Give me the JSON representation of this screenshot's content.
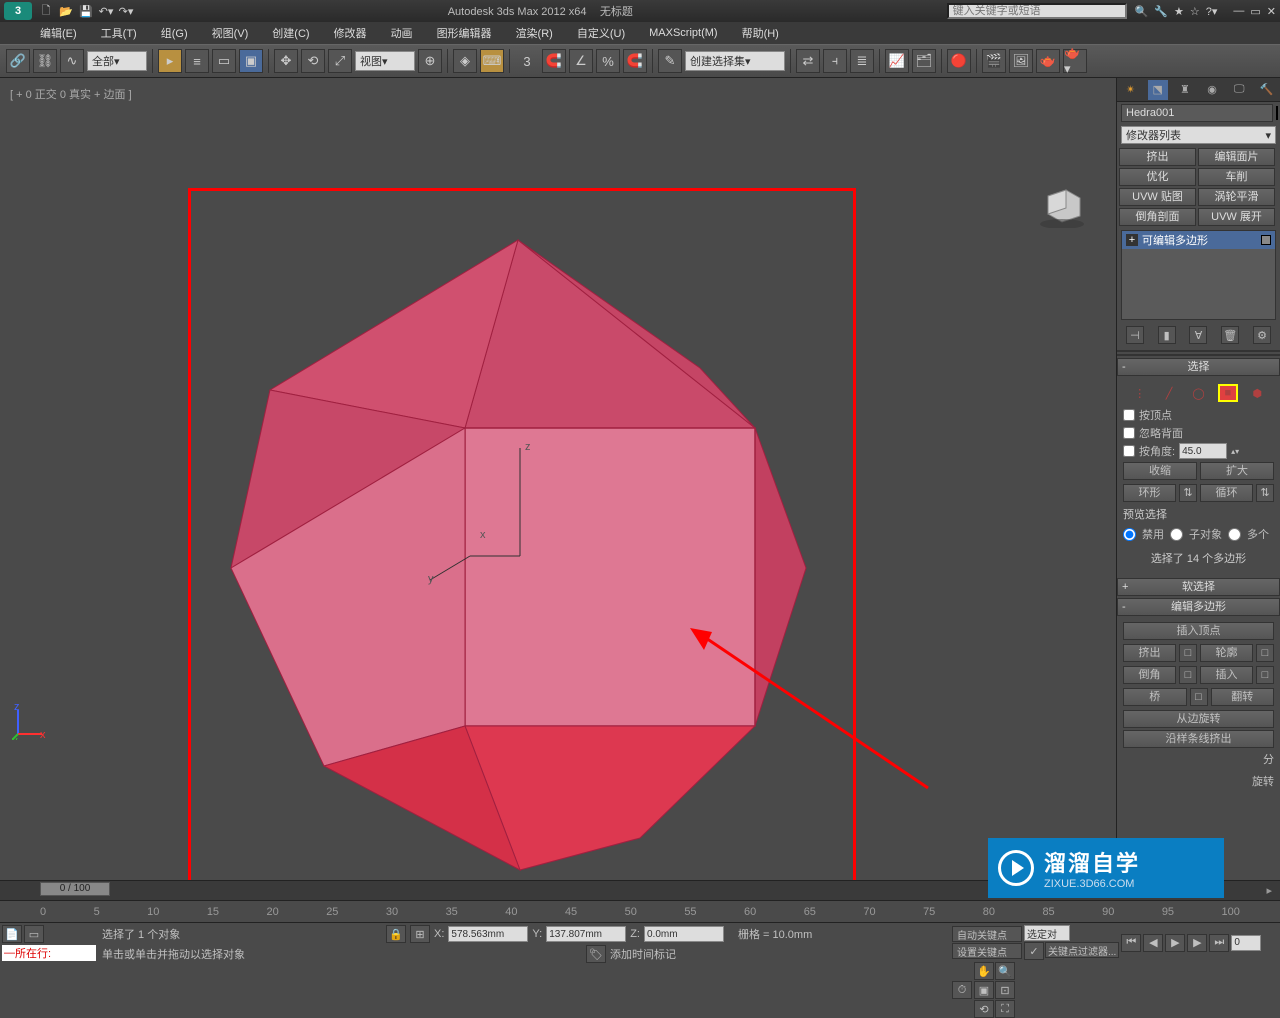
{
  "title": "Autodesk 3ds Max  2012 x64",
  "doc_title": "无标题",
  "search_placeholder": "键入关键字或短语",
  "menu": {
    "edit": "编辑(E)",
    "tools": "工具(T)",
    "group": "组(G)",
    "views": "视图(V)",
    "create": "创建(C)",
    "modifiers": "修改器",
    "anim": "动画",
    "graph": "图形编辑器",
    "render": "渲染(R)",
    "custom": "自定义(U)",
    "max": "MAXScript(M)",
    "help": "帮助(H)"
  },
  "filter_all": "全部",
  "view_dropdown": "视图",
  "create_set": "创建选择集",
  "vp_label": "[ + 0 正交 0 真实 + 边面 ]",
  "object_name": "Hedra001",
  "modifier_list": "修改器列表",
  "mod_buttons": {
    "extrude": "挤出",
    "editface": "编辑面片",
    "optimize": "优化",
    "lathe": "车削",
    "uvwmap": "UVW 贴图",
    "turbo": "涡轮平滑",
    "chamfer": "倒角剖面",
    "uvwunwrap": "UVW 展开"
  },
  "edit_poly_label": "可编辑多边形",
  "rollout_select": "选择",
  "by_vertex": "按顶点",
  "ignore_back": "忽略背面",
  "by_angle": "按角度:",
  "angle_val": "45.0",
  "shrink": "收缩",
  "grow": "扩大",
  "ring": "环形",
  "loop": "循环",
  "preview_sel": "预览选择",
  "radio_disable": "禁用",
  "radio_subobj": "子对象",
  "radio_multi": "多个",
  "sel_count": "选择了 14 个多边形",
  "rollout_soft": "软选择",
  "rollout_editpoly": "编辑多边形",
  "insert_vertex": "插入顶点",
  "ep_extrude": "挤出",
  "ep_outline": "轮廓",
  "ep_bevel": "倒角",
  "ep_insert": "插入",
  "ep_bridge": "桥",
  "ep_flip": "翻转",
  "from_edge": "从边旋转",
  "along_spline": "沿样条线挤出",
  "split": "分",
  "rotate": "旋转",
  "time_display": "0 / 100",
  "ruler": [
    "0",
    "5",
    "10",
    "15",
    "20",
    "25",
    "30",
    "35",
    "40",
    "45",
    "50",
    "55",
    "60",
    "65",
    "70",
    "75",
    "80",
    "85",
    "90",
    "95",
    "100"
  ],
  "status_sel": "选择了 1 个对象",
  "status_hint": "单击或单击并拖动以选择对象",
  "status_row": "所在行:",
  "x_val": "578.563mm",
  "y_val": "137.807mm",
  "z_val": "0.0mm",
  "grid": "栅格 = 10.0mm",
  "add_time_tag": "添加时间标记",
  "auto_key": "自动关键点",
  "sel_pair": "选定对",
  "set_key": "设置关键点",
  "key_filter": "关键点过滤器...",
  "wm_main": "溜溜自学",
  "wm_sub": "ZIXUE.3D66.COM"
}
